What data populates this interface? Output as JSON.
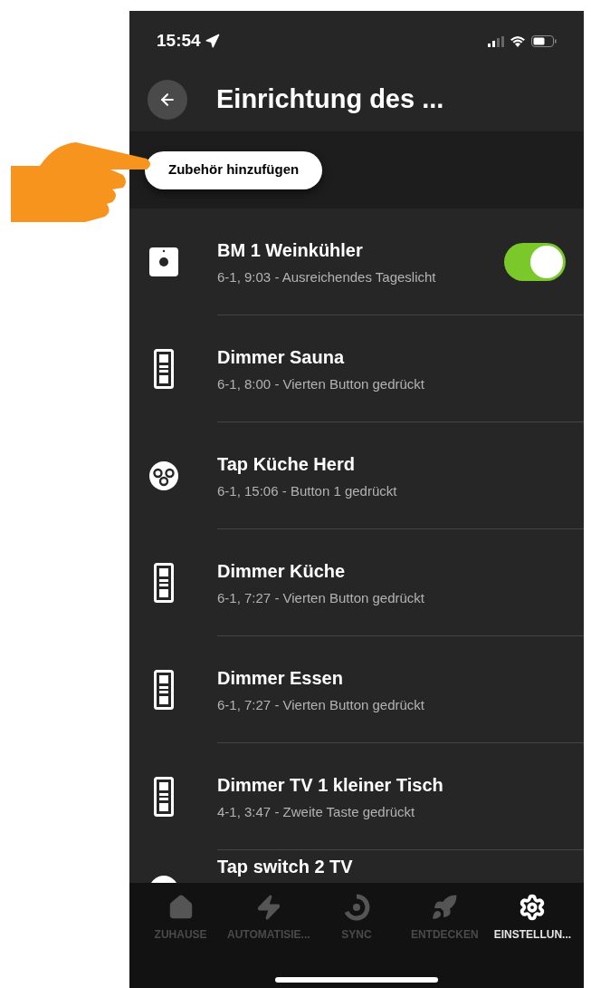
{
  "status_bar": {
    "time": "15:54"
  },
  "header": {
    "title": "Einrichtung des ..."
  },
  "add_button": {
    "label": "Zubehör hinzufügen"
  },
  "accessories": [
    {
      "kind": "sensor",
      "name": "BM 1 Weinkühler",
      "status": "6-1, 9:03 - Ausreichendes Tageslicht",
      "toggle": {
        "on": true
      }
    },
    {
      "kind": "dimmer",
      "name": "Dimmer Sauna",
      "status": "6-1, 8:00 - Vierten Button gedrückt"
    },
    {
      "kind": "tap",
      "name": "Tap Küche Herd",
      "status": "6-1, 15:06 - Button 1 gedrückt"
    },
    {
      "kind": "dimmer",
      "name": "Dimmer Küche",
      "status": "6-1, 7:27 - Vierten Button gedrückt"
    },
    {
      "kind": "dimmer",
      "name": "Dimmer Essen",
      "status": "6-1, 7:27 - Vierten Button gedrückt"
    },
    {
      "kind": "dimmer",
      "name": "Dimmer TV 1 kleiner Tisch",
      "status": "4-1, 3:47 - Zweite Taste gedrückt"
    },
    {
      "kind": "tap",
      "name": "Tap switch 2 TV"
    }
  ],
  "tab_bar": [
    {
      "kind": "home",
      "label": "ZUHAUSE",
      "selected": false
    },
    {
      "kind": "automation",
      "label": "AUTOMATISIE...",
      "selected": false
    },
    {
      "kind": "sync",
      "label": "SYNC",
      "selected": false
    },
    {
      "kind": "explore",
      "label": "ENTDECKEN",
      "selected": false
    },
    {
      "kind": "settings",
      "label": "EINSTELLUN...",
      "selected": true
    }
  ]
}
